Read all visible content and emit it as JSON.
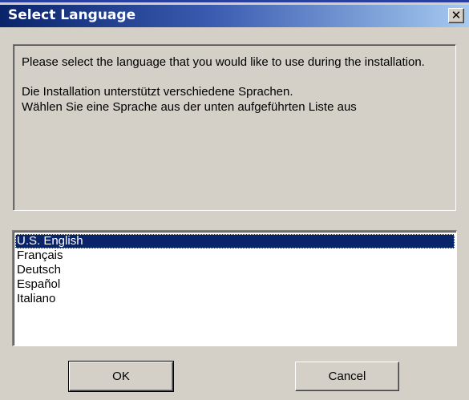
{
  "window": {
    "title": "Select Language",
    "close_glyph": "✕",
    "colors": {
      "title_start": "#0a246a",
      "title_end": "#a6caf0",
      "face": "#d4d0c8",
      "selection": "#0a246a"
    }
  },
  "message": {
    "line1": "Please select the language that you would like to use during the installation.",
    "line2": "Die Installation unterstützt verschiedene Sprachen.",
    "line3": "Wählen Sie eine Sprache aus der unten aufgeführten Liste aus"
  },
  "languages": {
    "selected": "U.S. English",
    "items": [
      "U.S. English",
      "Français",
      "Deutsch",
      "Español",
      "Italiano"
    ]
  },
  "buttons": {
    "ok": "OK",
    "cancel": "Cancel"
  }
}
